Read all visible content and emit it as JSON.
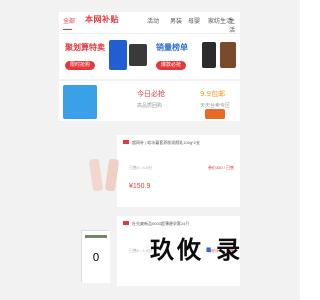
{
  "nav": {
    "tabs": [
      "全部",
      "活动",
      "男装",
      "母婴",
      "家纺生活",
      "生活"
    ],
    "logo": "本网补贴"
  },
  "hero": {
    "left_title": "聚划算特卖",
    "left_button": "限时抢购",
    "right_title": "销量榜单",
    "right_button": "爆款必抢"
  },
  "row2": {
    "left_title": "今日必抢",
    "left_sub": "高品质回购",
    "right_title": "9.9包邮",
    "right_sub": "天天台卖专区"
  },
  "products": [
    {
      "tag_label": "",
      "name": "超网补 | 软冰蔓套养肤润颜乳100g*2支",
      "meta_left": "已售0 / 4.5分",
      "meta_right": "券价350 / 已售",
      "price": "¥150.9"
    },
    {
      "tag_label": "",
      "name": "杜兑爽新品0003超薄避孕套24只",
      "meta_left": "已售0 / 4.5分",
      "meta_right": "券价350 / 已售",
      "price": ""
    }
  ],
  "watermark": {
    "text_left": "玖",
    "text_mid": "攸",
    "text_right": "录"
  },
  "colors": {
    "accent": "#e4393c",
    "background": "#f2f2f2",
    "title_red": "#e4393c",
    "title_blue": "#2e6fd6",
    "title_orange": "#f29a2e"
  }
}
